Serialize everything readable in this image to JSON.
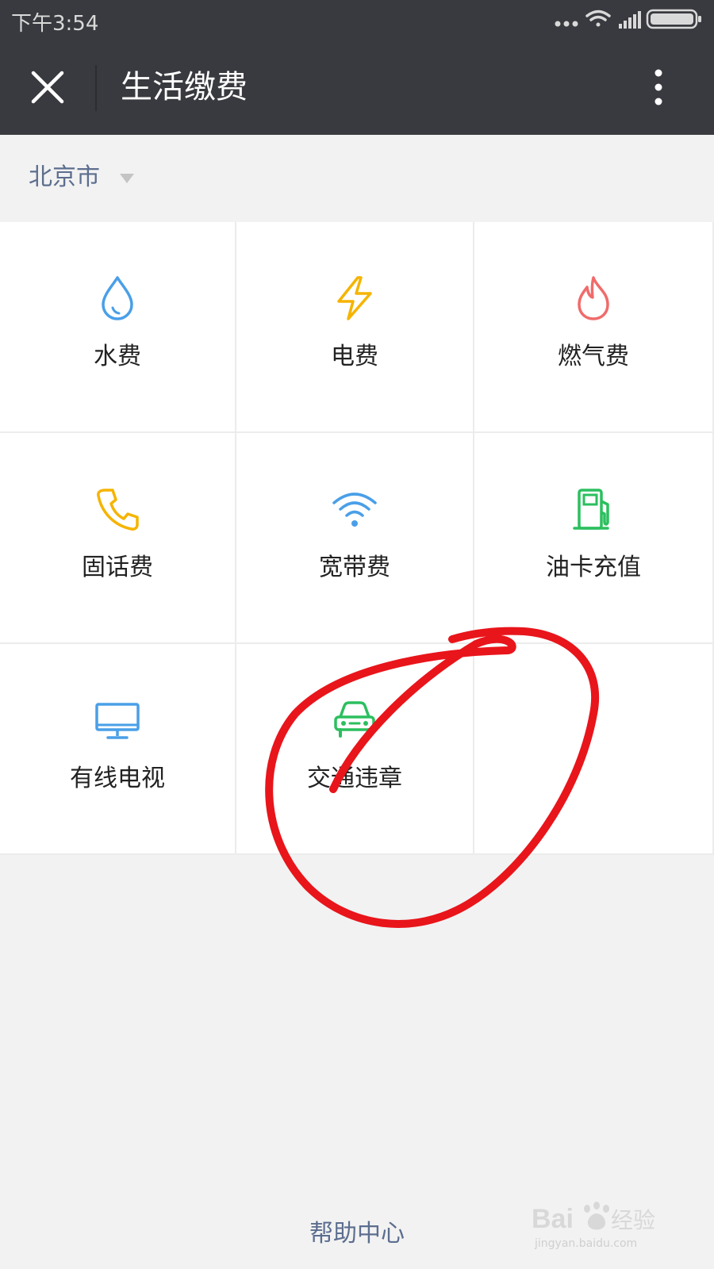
{
  "status_bar": {
    "time": "下午3:54",
    "icons": [
      "more-dots-icon",
      "wifi-signal-icon",
      "cellular-signal-icon",
      "battery-icon"
    ]
  },
  "header": {
    "title": "生活缴费",
    "close_icon": "close-icon",
    "more_icon": "more-vertical-icon",
    "background": "#393a3f"
  },
  "city": {
    "name": "北京市",
    "arrow_icon": "dropdown-triangle-icon"
  },
  "services": [
    {
      "label": "水费",
      "icon": "water-drop-icon",
      "color": "#4a9fe8"
    },
    {
      "label": "电费",
      "icon": "lightning-icon",
      "color": "#f5b400"
    },
    {
      "label": "燃气费",
      "icon": "flame-icon",
      "color": "#f06b6b"
    },
    {
      "label": "固话费",
      "icon": "phone-icon",
      "color": "#f5b400"
    },
    {
      "label": "宽带费",
      "icon": "wifi-icon",
      "color": "#4a9fe8"
    },
    {
      "label": "油卡充值",
      "icon": "fuel-pump-icon",
      "color": "#2bbf5e"
    },
    {
      "label": "有线电视",
      "icon": "tv-monitor-icon",
      "color": "#4a9fe8"
    },
    {
      "label": "交通违章",
      "icon": "car-icon",
      "color": "#2bbf5e"
    }
  ],
  "footer": {
    "help_label": "帮助中心"
  },
  "annotation": {
    "color": "#e8151b",
    "shape": "hand-drawn-circle-around-交通违章"
  },
  "watermark": {
    "brand": "Baidu经验",
    "url": "jingyan.baidu.com"
  }
}
